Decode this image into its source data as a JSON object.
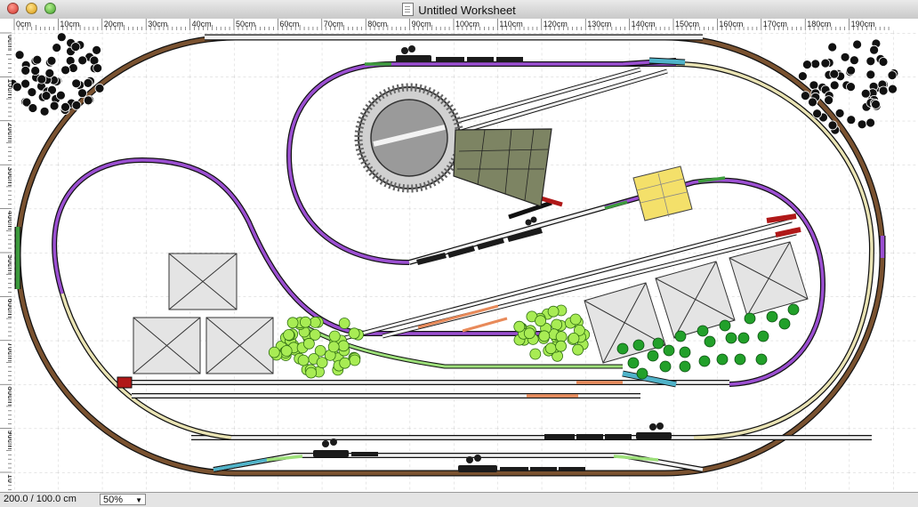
{
  "window": {
    "title": "Untitled Worksheet"
  },
  "ruler": {
    "top_labels": [
      "0cm",
      "10cm",
      "20cm",
      "30cm",
      "40cm",
      "50cm",
      "60cm",
      "70cm",
      "80cm",
      "90cm",
      "100cm",
      "110cm",
      "120cm",
      "130cm",
      "140cm",
      "150cm",
      "160cm",
      "170cm",
      "180cm",
      "190cm"
    ],
    "left_labels": [
      "0cm",
      "10cm",
      "20cm",
      "30cm",
      "40cm",
      "50cm",
      "60cm",
      "70cm",
      "80cm",
      "90cm",
      "10"
    ]
  },
  "status": {
    "dimensions": "200.0 / 100.0 cm",
    "zoom": "50%"
  },
  "colors": {
    "track_brown": "#7a5230",
    "track_purple": "#9b4fd1",
    "track_cream": "#e9e3b4",
    "track_green": "#3d9b3d",
    "track_lime": "#9de07a",
    "track_blue": "#4fb3c9",
    "track_orange": "#e88a5a",
    "building_fill": "#e4e4e4",
    "engine_shed": "#7d8463",
    "turntable": "#9a9a9a",
    "platform_yellow": "#f4e06a",
    "tree_lime": "#a8ec54",
    "tree_green": "#22a02a",
    "buffer_red": "#b01818"
  }
}
